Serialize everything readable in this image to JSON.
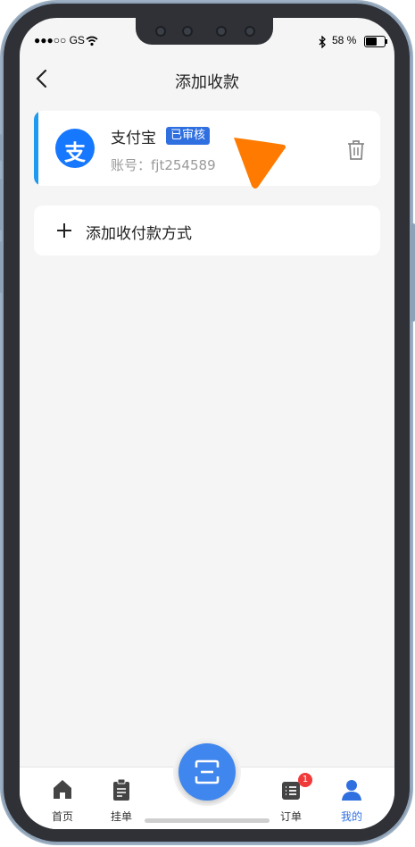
{
  "status_bar": {
    "carrier": "●●●○○ GS",
    "battery": "58 %"
  },
  "nav": {
    "title": "添加收款"
  },
  "payment_card": {
    "name": "支付宝",
    "badge": "已审核",
    "account_label": "账号：",
    "account_value": "fjt254589",
    "accent_color": "#1f9af0",
    "logo_glyph": "支"
  },
  "add_method": {
    "label": "添加收付款方式"
  },
  "tabbar": {
    "tabs": [
      {
        "label": "首页",
        "icon": "home-icon"
      },
      {
        "label": "挂单",
        "icon": "clipboard-icon"
      },
      {
        "label": "订单",
        "icon": "order-list-icon",
        "badge": "1"
      },
      {
        "label": "我的",
        "icon": "user-icon",
        "active": true
      }
    ],
    "center_icon": "scan-icon",
    "active_color": "#2f6fe0"
  }
}
